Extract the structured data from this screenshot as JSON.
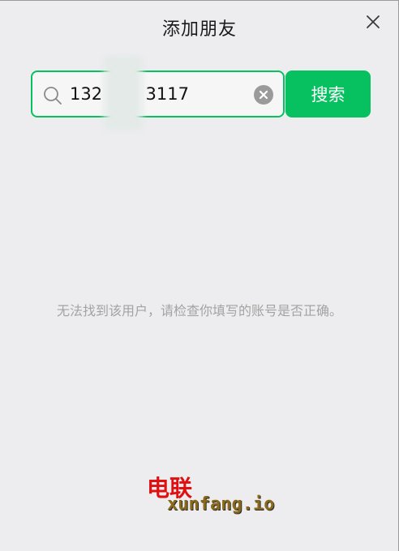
{
  "dialog": {
    "title": "添加朋友"
  },
  "search": {
    "value": "132        3117",
    "icon": "search-icon",
    "clear_icon": "clear-icon"
  },
  "search_button": {
    "label": "搜索"
  },
  "result": {
    "message": "无法找到该用户，请检查你填写的账号是否正确。"
  },
  "watermark": {
    "line1": "电联",
    "line2": "xunfang.io"
  },
  "colors": {
    "accent": "#07c160",
    "background": "#ededef",
    "message_text": "#a3a3a3"
  }
}
